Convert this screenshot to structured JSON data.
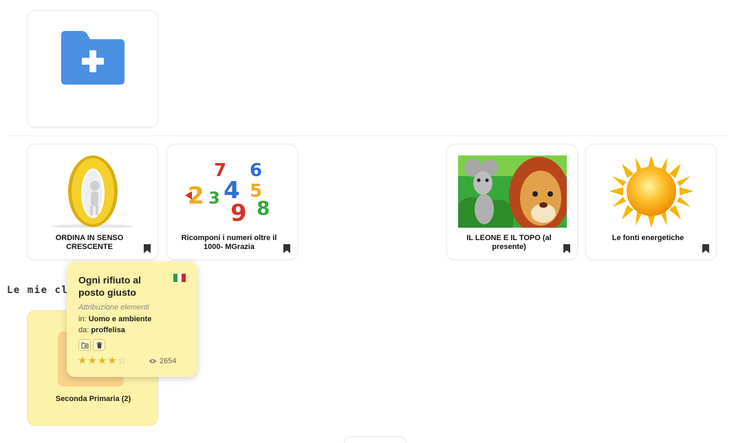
{
  "colors": {
    "folder_blue": "#4a90e2",
    "card_yellow": "#fdf2a9",
    "star": "#e3b42a"
  },
  "new_folder": {
    "icon": "folder-plus-icon"
  },
  "activities": [
    {
      "title": "ORDINA IN SENSO CRESCENTE"
    },
    {
      "title": "Ricomponi i numeri oltre il 1000- MGrazia"
    },
    {
      "title": "IL LEONE E IL TOPO (al presente)"
    },
    {
      "title": "Le fonti energetiche"
    }
  ],
  "section": {
    "title": "Le mie cl"
  },
  "class_card": {
    "label": "Seconda Primaria (2)"
  },
  "popup": {
    "title": "Ogni rifiuto al posto giusto",
    "type": "Attribuzione elementi",
    "in_label": "in:",
    "in_value": "Uomo e ambiente",
    "by_label": "da:",
    "by_value": "proffelisa",
    "rating": 4,
    "rating_max": 5,
    "views": "2654"
  }
}
